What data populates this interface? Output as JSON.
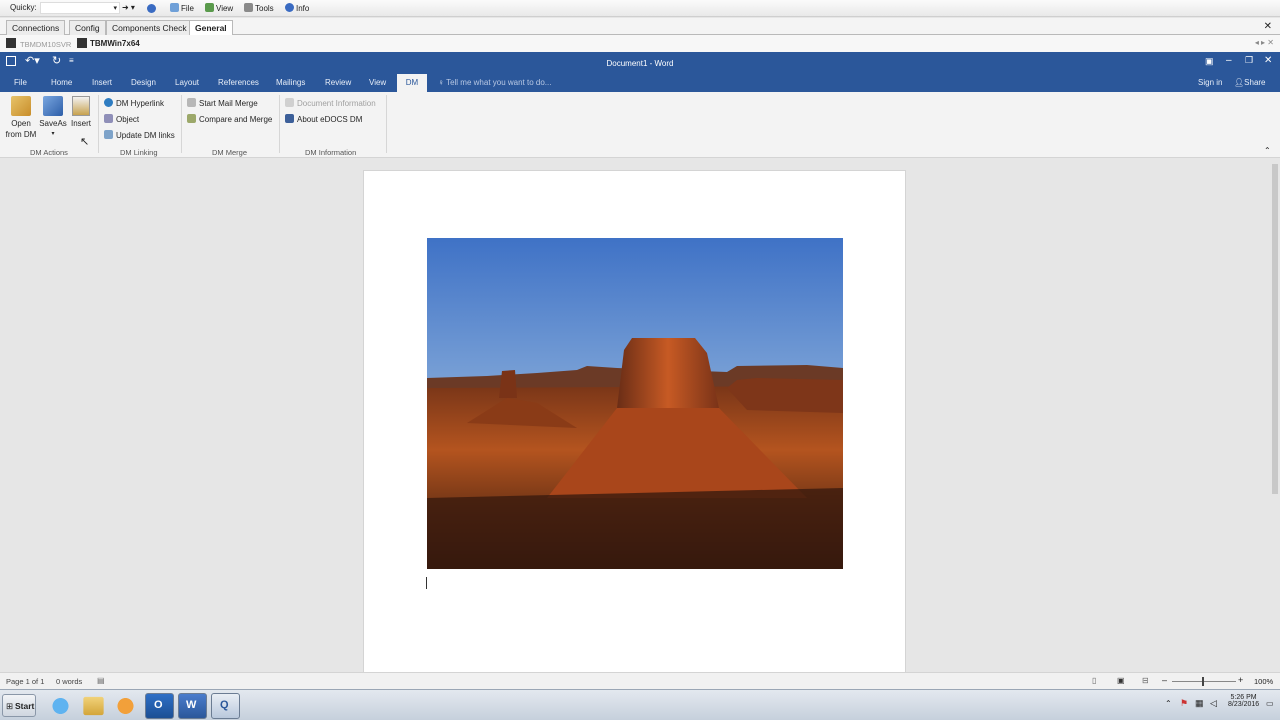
{
  "quicky": {
    "label": "Quicky:",
    "file": "File",
    "view": "View",
    "tools": "Tools",
    "info": "Info"
  },
  "tabs": [
    "Connections",
    "Config",
    "Components Check",
    "General"
  ],
  "sessions": [
    "TBMDM10SVR",
    "TBMWin7x64"
  ],
  "word": {
    "title": "Document1 - Word",
    "sign_in": "Sign in",
    "share": "Share",
    "ribbon_tabs": [
      "File",
      "Home",
      "Insert",
      "Design",
      "Layout",
      "References",
      "Mailings",
      "Review",
      "View",
      "DM"
    ],
    "tell_me": "Tell me what you want to do..."
  },
  "ribbon": {
    "actions": {
      "open": "Open",
      "open2": "from DM",
      "saveas": "SaveAs",
      "insert": "Insert",
      "label": "DM Actions"
    },
    "linking": {
      "items": [
        "DM Hyperlink",
        "Object",
        "Update DM links"
      ],
      "label": "DM Linking"
    },
    "merge": {
      "items": [
        "Start Mail Merge",
        "Compare and Merge"
      ],
      "label": "DM Merge"
    },
    "info": {
      "items": [
        "Document Information",
        "About eDOCS DM"
      ],
      "label": "DM Information"
    }
  },
  "status": {
    "page": "Page 1 of 1",
    "words": "0 words",
    "zoom": "100%"
  },
  "taskbar": {
    "start": "Start",
    "time": "5:26 PM",
    "date": "8/23/2016"
  },
  "colors": {
    "word_blue": "#2b579a",
    "ribbon_bg": "#f3f3f3"
  }
}
